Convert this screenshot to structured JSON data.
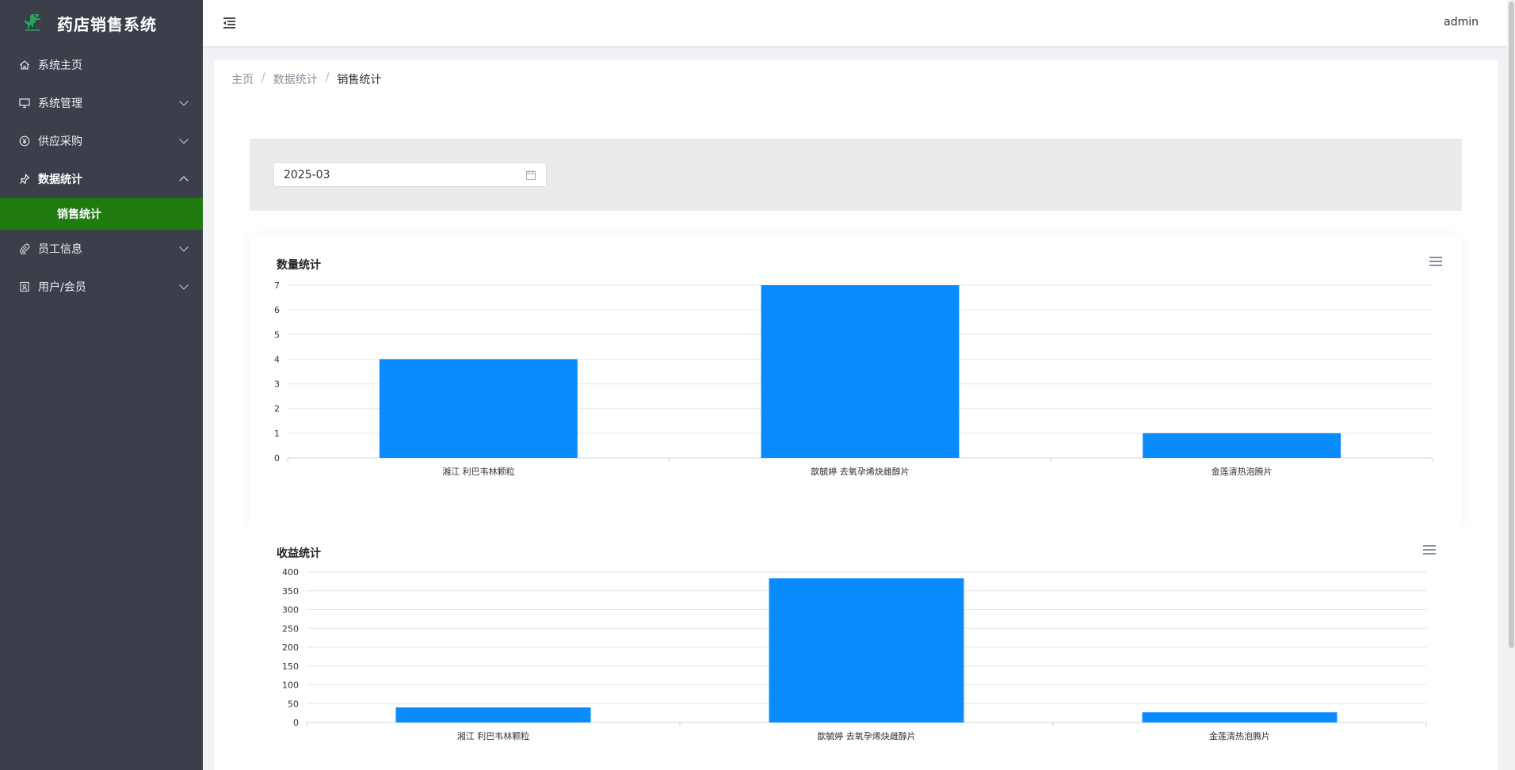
{
  "app": {
    "title": "药店销售系统"
  },
  "sidebar": {
    "items": [
      {
        "label": "系统主页",
        "icon": "home-icon",
        "has_children": false
      },
      {
        "label": "系统管理",
        "icon": "monitor-icon",
        "has_children": true
      },
      {
        "label": "供应采购",
        "icon": "yen-icon",
        "has_children": true
      },
      {
        "label": "数据统计",
        "icon": "pin-icon",
        "has_children": true,
        "expanded": true,
        "children": [
          "销售统计"
        ]
      },
      {
        "label": "员工信息",
        "icon": "paperclip-icon",
        "has_children": true
      },
      {
        "label": "用户/会员",
        "icon": "document-icon",
        "has_children": true
      }
    ],
    "active_child": "销售统计",
    "colors": {
      "bg": "#3a3f4a",
      "active_bg": "#1f7a10"
    }
  },
  "header": {
    "user": "admin"
  },
  "breadcrumb": [
    "主页",
    "数据统计",
    "销售统计"
  ],
  "filter": {
    "month": "2025-03"
  },
  "chart_data": [
    {
      "type": "bar",
      "title": "数量统计",
      "categories": [
        "湘江 利巴韦林颗粒",
        "歆毓婷 去氧孕烯炔雌醇片",
        "金莲清热泡腾片"
      ],
      "values": [
        4,
        7,
        1
      ],
      "ylim": [
        0,
        7
      ],
      "yticks": [
        0,
        1,
        2,
        3,
        4,
        5,
        6,
        7
      ],
      "color": "#0a8cff",
      "grid": true
    },
    {
      "type": "bar",
      "title": "收益统计",
      "categories": [
        "湘江 利巴韦林颗粒",
        "歆毓婷 去氧孕烯炔雌醇片",
        "金莲清热泡腾片"
      ],
      "values": [
        40,
        383,
        27
      ],
      "ylim": [
        0,
        400
      ],
      "yticks": [
        0,
        50,
        100,
        150,
        200,
        250,
        300,
        350,
        400
      ],
      "color": "#0a8cff",
      "grid": true
    }
  ]
}
